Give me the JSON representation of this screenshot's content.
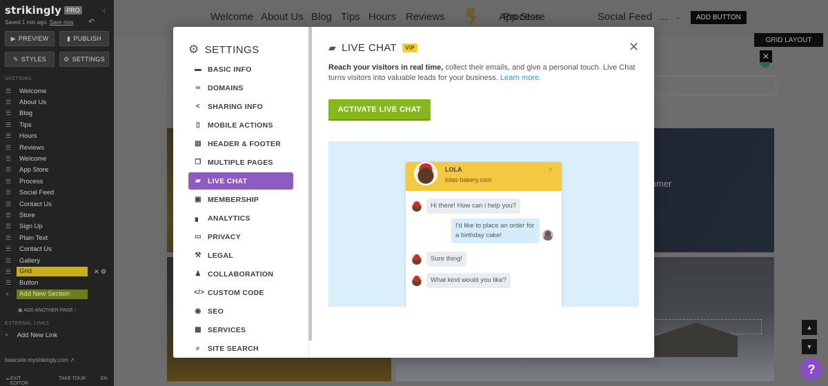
{
  "editor": {
    "logo": "strikingly",
    "pro_badge": "PRO",
    "saved_text": "Saved 1 min ago.",
    "save_now": "Save now",
    "buttons": {
      "preview": "PREVIEW",
      "publish": "PUBLISH",
      "styles": "STYLES",
      "settings": "SETTINGS"
    },
    "sections_label": "SECTIONS",
    "sections": [
      "Welcome",
      "About Us",
      "Blog",
      "Tips",
      "Hours",
      "Reviews",
      "Welcome",
      "App Store",
      "Process",
      "Social Feed",
      "Contact Us",
      "Store",
      "Sign Up",
      "Plain Text",
      "Contact Us",
      "Gallery",
      "Grid",
      "Button"
    ],
    "active_section": "Grid",
    "add_section": "Add New Section",
    "add_page": "ADD ANOTHER PAGE ›",
    "external_links_label": "EXTERNAL LINKS",
    "add_link": "Add New Link",
    "site_url": "basicsite.mystrikingly.com",
    "footer": {
      "exit": "EXIT EDITOR",
      "tour": "TAKE TOUR",
      "lang": "EN"
    }
  },
  "site": {
    "nav_links": [
      "Welcome",
      "About Us",
      "Blog",
      "Tips",
      "Hours",
      "Reviews",
      "App Store",
      "Process",
      "Social Feed"
    ],
    "nav_more": "...",
    "add_button": "ADD BUTTON",
    "grid_layout": "GRID LAYOUT",
    "summer_text": "mmer",
    "help": "?"
  },
  "settings": {
    "title": "SETTINGS",
    "items": [
      {
        "label": "BASIC INFO",
        "icon": "briefcase-icon",
        "glyph": "▬"
      },
      {
        "label": "DOMAINS",
        "icon": "link-icon",
        "glyph": "∞"
      },
      {
        "label": "SHARING INFO",
        "icon": "share-icon",
        "glyph": "<"
      },
      {
        "label": "MOBILE ACTIONS",
        "icon": "mobile-icon",
        "glyph": "▯"
      },
      {
        "label": "HEADER & FOOTER",
        "icon": "header-footer-icon",
        "glyph": "▤"
      },
      {
        "label": "MULTIPLE PAGES",
        "icon": "pages-icon",
        "glyph": "❐"
      },
      {
        "label": "LIVE CHAT",
        "icon": "chat-icon",
        "glyph": "▰"
      },
      {
        "label": "MEMBERSHIP",
        "icon": "membership-icon",
        "glyph": "▣"
      },
      {
        "label": "ANALYTICS",
        "icon": "analytics-icon",
        "glyph": "▖"
      },
      {
        "label": "PRIVACY",
        "icon": "lock-icon",
        "glyph": "▭"
      },
      {
        "label": "LEGAL",
        "icon": "gavel-icon",
        "glyph": "⚒"
      },
      {
        "label": "COLLABORATION",
        "icon": "users-icon",
        "glyph": "♟"
      },
      {
        "label": "CUSTOM CODE",
        "icon": "code-icon",
        "glyph": "</>"
      },
      {
        "label": "SEO",
        "icon": "seo-icon",
        "glyph": "◉"
      },
      {
        "label": "SERVICES",
        "icon": "services-icon",
        "glyph": "▦"
      },
      {
        "label": "SITE SEARCH",
        "icon": "search-icon",
        "glyph": "⌕"
      }
    ],
    "active_item": "LIVE CHAT"
  },
  "live_chat": {
    "title": "LIVE CHAT",
    "badge": "VIP",
    "desc_bold": "Reach your visitors in real time,",
    "desc_rest": " collect their emails, and give a personal touch. Live Chat turns visitors into valuable leads for your business.",
    "learn_more": "Learn more.",
    "activate": "ACTIVATE LIVE CHAT",
    "preview": {
      "agent_name": "LOLA",
      "agent_site": "lolas-bakery.com",
      "messages": [
        {
          "from": "agent",
          "text": "Hi there! How can i help you?"
        },
        {
          "from": "user",
          "text": "I'd like to place an order for a birthday cake!"
        },
        {
          "from": "agent",
          "text": "Sure thing!"
        },
        {
          "from": "agent",
          "text": "What kind would you like?"
        }
      ]
    }
  },
  "colors": {
    "accent_purple": "#8d5bc1",
    "activate_green": "#86b81d",
    "vip_yellow": "#f2d12e",
    "chat_header": "#f5c842",
    "preview_bg": "#daeefb",
    "link_blue": "#2e9bd3"
  }
}
